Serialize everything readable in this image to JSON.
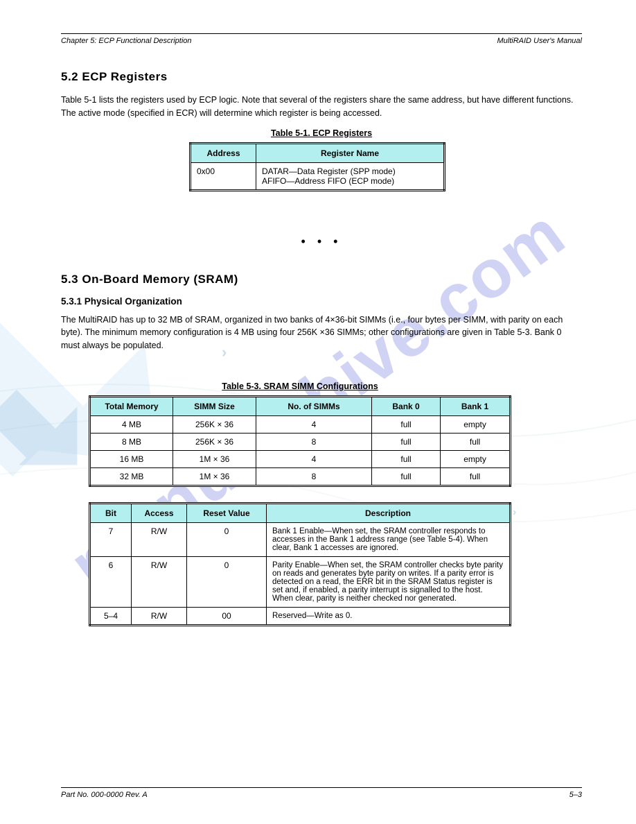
{
  "header": {
    "left": "Chapter 5: ECP Functional Description",
    "right": "MultiRAID User's Manual"
  },
  "section1": {
    "title": "5.2 ECP Registers",
    "intro": "Table 5-1 lists the registers used by ECP logic. Note that several of the registers share the same address, but have different functions. The active mode (specified in ECR) will determine which register is being accessed.",
    "tableTitle": "Table 5-1.  ECP Registers",
    "tableHeaders": [
      "Address",
      "Register Name"
    ],
    "tableRows": [
      {
        "addr": "0x00",
        "name": "DATAR—Data Register (SPP mode)\nAFIFO—Address FIFO (ECP mode)"
      }
    ]
  },
  "dots": "• • •",
  "section2": {
    "title": "5.3 On-Board Memory (SRAM)",
    "sub1": {
      "title": "5.3.1 Physical Organization",
      "para": "The MultiRAID has up to 32 MB of SRAM, organized in two banks of 4×36-bit SIMMs (i.e., four bytes per SIMM, with parity on each byte). The minimum memory configuration is 4 MB using four 256K ×36 SIMMs; other configurations are given in Table 5-3. Bank 0 must always be populated."
    }
  },
  "table3": {
    "title": "Table 5-3.  SRAM SIMM Configurations",
    "headers": [
      "Total Memory",
      "SIMM Size",
      "No. of SIMMs",
      "Bank 0",
      "Bank 1"
    ],
    "rows": [
      [
        "4 MB",
        "256K × 36",
        "4",
        "full",
        "empty"
      ],
      [
        "8 MB",
        "256K × 36",
        "8",
        "full",
        "full"
      ],
      [
        "16 MB",
        "1M × 36",
        "4",
        "full",
        "empty"
      ],
      [
        "32 MB",
        "1M × 36",
        "8",
        "full",
        "full"
      ]
    ]
  },
  "table4": {
    "headers": [
      "Bit",
      "Access",
      "Reset Value",
      "Description"
    ],
    "rows": [
      {
        "bit": "7",
        "access": "R/W",
        "reset": "0",
        "desc": "Bank 1 Enable—When set, the SRAM controller responds to accesses in the Bank 1 address range (see Table 5-4). When clear, Bank 1 accesses are ignored."
      },
      {
        "bit": "6",
        "access": "R/W",
        "reset": "0",
        "desc": "Parity Enable—When set, the SRAM controller checks byte parity on reads and generates byte parity on writes. If a parity error is detected on a read, the ERR bit in the SRAM Status register is set and, if enabled, a parity interrupt is signalled to the host. When clear, parity is neither checked nor generated."
      },
      {
        "bit": "5–4",
        "access": "R/W",
        "reset": "00",
        "desc": "Reserved—Write as 0."
      }
    ]
  },
  "footer": {
    "left": "Part No. 000-0000   Rev. A",
    "right": "5–3"
  }
}
